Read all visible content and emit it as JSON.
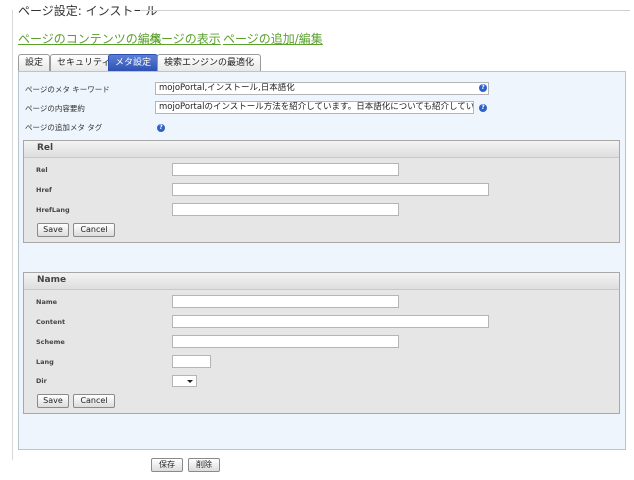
{
  "page": {
    "title": "ページ設定: インストール"
  },
  "top_links": [
    {
      "label": "ページのコンテンツの編集"
    },
    {
      "label": "ページの表示"
    },
    {
      "label": "ページの追加/編集"
    }
  ],
  "tabs": [
    {
      "label": "設定"
    },
    {
      "label": "セキュリティ"
    },
    {
      "label": "メタ設定"
    },
    {
      "label": "検索エンジンの最適化"
    }
  ],
  "meta": {
    "keywords_label": "ページのメタ キーワード",
    "keywords_value": "mojoPortal,インストール,日本語化",
    "description_label": "ページの内容要約",
    "description_value": "mojoPortalのインストール方法を紹介しています。日本語化についても紹介しています。",
    "additional_tags_label": "ページの追加メタ タグ",
    "help_glyph": "?"
  },
  "rel_group": {
    "title": "Rel",
    "rel_label": "Rel",
    "href_label": "Href",
    "hreflang_label": "HrefLang",
    "save_label": "Save",
    "cancel_label": "Cancel"
  },
  "name_group": {
    "title": "Name",
    "name_label": "Name",
    "content_label": "Content",
    "scheme_label": "Scheme",
    "lang_label": "Lang",
    "dir_label": "Dir",
    "save_label": "Save",
    "cancel_label": "Cancel"
  },
  "footer": {
    "save_label": "保存",
    "delete_label": "削除"
  },
  "colors": {
    "link": "#5aa02c",
    "tab_active": "#2c4fb0",
    "panel_bg": "#eef5fd",
    "help_icon": "#2f62c8"
  }
}
